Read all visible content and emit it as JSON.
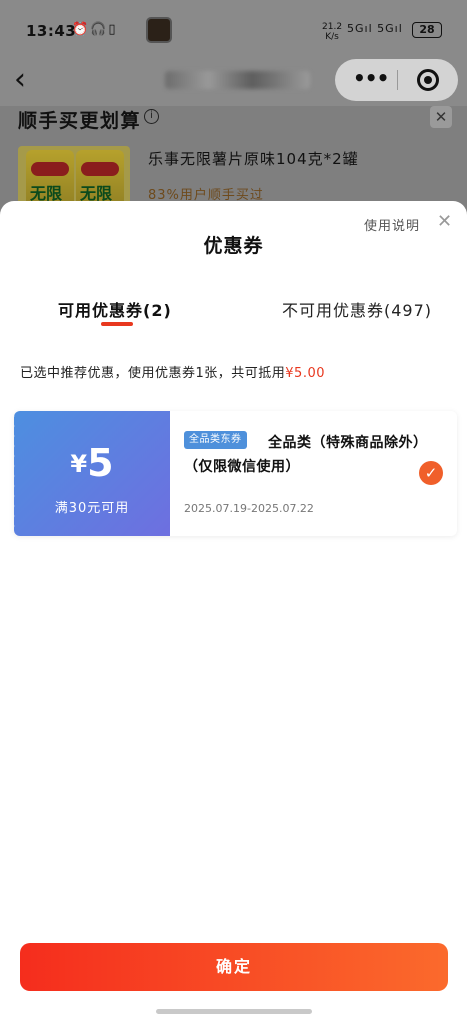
{
  "status_bar": {
    "time": "13:43",
    "left_icons": "⏰🎧▯",
    "net_speed_value": "21.2",
    "net_speed_unit": "K/s",
    "signal": "5Gıl 5Gıl",
    "battery": "28"
  },
  "header": {
    "back_icon": "chevron-left-icon",
    "more_icon": "•••",
    "capsule_close_icon": "target-icon"
  },
  "background_section": {
    "title": "顺手买更划算",
    "info_icon": "i",
    "close_icon": "✕",
    "product_name": "乐事无限薯片原味104克*2罐",
    "product_rate": "83%用户顺手买过"
  },
  "sheet": {
    "help_link": "使用说明",
    "close_icon": "✕",
    "title": "优惠券",
    "tabs": [
      {
        "label": "可用优惠券(2)",
        "active": true
      },
      {
        "label": "不可用优惠券(497)",
        "active": false
      }
    ],
    "summary": {
      "text": "已选中推荐优惠，使用优惠券1张，共可抵用",
      "amount": "¥5.00"
    },
    "coupons": [
      {
        "currency": "¥",
        "amount": "5",
        "condition": "满30元可用",
        "tag": "全品类东券",
        "title": "全品类（特殊商品除外）（仅限微信使用）",
        "valid_dates": "2025.07.19-2025.07.22",
        "selected": true,
        "check_icon": "✓"
      }
    ],
    "confirm_label": "确定"
  },
  "colors": {
    "accent": "#e8381f",
    "coupon_gradient_start": "#4d8fe0",
    "coupon_gradient_end": "#6e6fe0",
    "check": "#f05f2a"
  }
}
